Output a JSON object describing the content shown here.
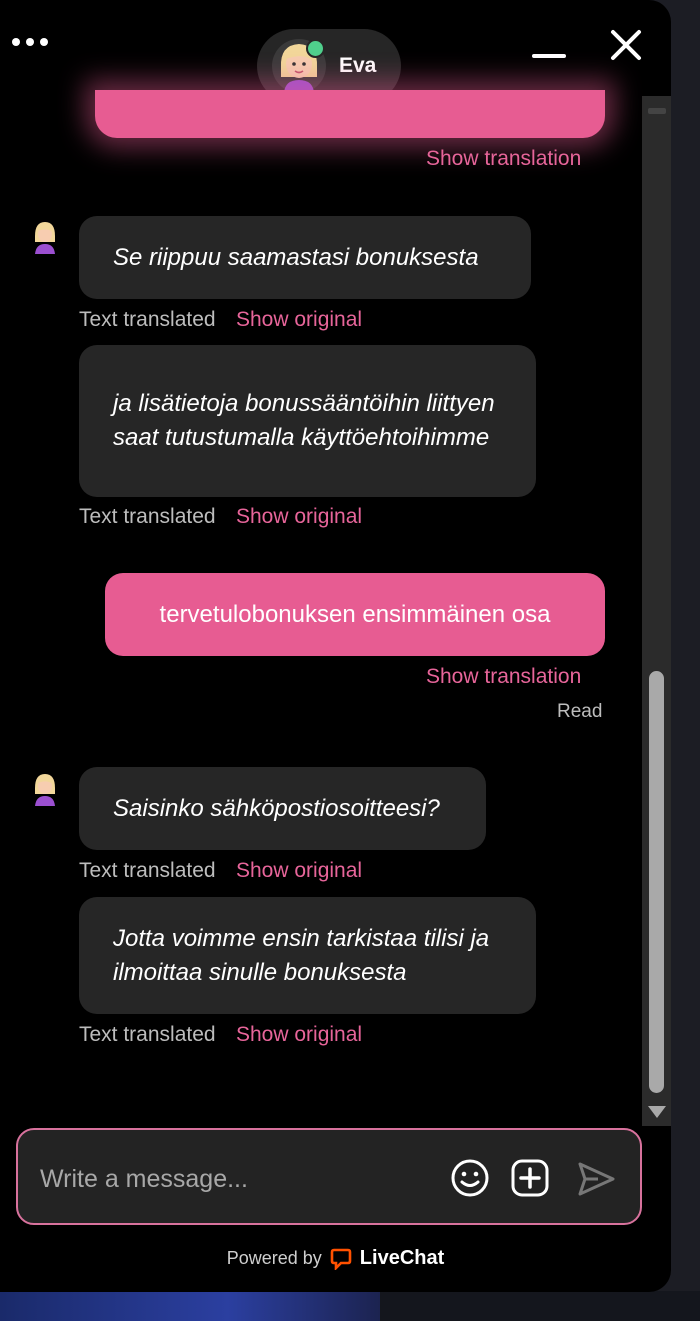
{
  "header": {
    "agent_name": "Eva",
    "online_color": "#4fcf8c",
    "menu_icon": "more-dots-icon",
    "minimize_icon": "minimize-icon",
    "close_icon": "close-icon"
  },
  "messages": {
    "top_show_translation": "Show translation",
    "agent_block_1": [
      {
        "text": "Se riippuu saamastasi bonuksesta",
        "status": "Text translated",
        "link": "Show original"
      },
      {
        "text": "ja lisätietoja bonussääntöihin liittyen saat tutustumalla käyttöehtoihimme",
        "status": "Text translated",
        "link": "Show original"
      }
    ],
    "user_message": {
      "text": "tervetulobonuksen ensimmäinen osa",
      "link": "Show translation",
      "receipt": "Read"
    },
    "agent_block_2": [
      {
        "text": "Saisinko sähköpostiosoitteesi?",
        "status": "Text translated",
        "link": "Show original"
      },
      {
        "text": "Jotta voimme ensin tarkistaa tilisi ja ilmoittaa sinulle bonuksesta",
        "status": "Text translated",
        "link": "Show original"
      }
    ]
  },
  "composer": {
    "placeholder": "Write a message...",
    "emoji_icon": "emoji-icon",
    "attach_icon": "add-attachment-icon",
    "send_icon": "send-icon"
  },
  "footer": {
    "powered_by": "Powered by",
    "brand": "LiveChat",
    "brand_color": "#ff5100"
  },
  "colors": {
    "accent": "#e75c92",
    "agent_bubble": "#262626",
    "background": "#000000"
  }
}
